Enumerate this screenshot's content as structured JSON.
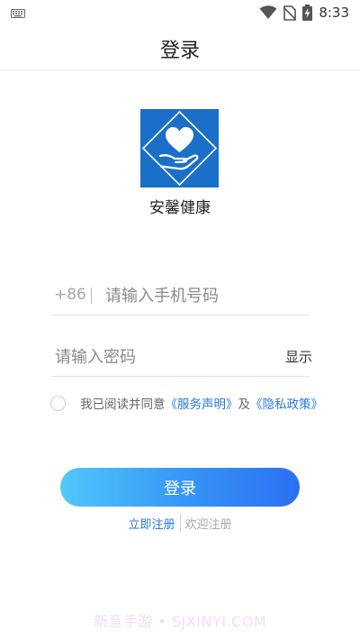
{
  "status_bar": {
    "time": "8:33",
    "icons": [
      "keyboard-icon",
      "wifi-icon",
      "no-sim-icon",
      "battery-charging-icon"
    ]
  },
  "header": {
    "title": "登录"
  },
  "app": {
    "name": "安馨健康",
    "logo_icon": "heart-hand-logo-icon",
    "logo_color": "#1a6fc9"
  },
  "phone_field": {
    "prefix": "+86",
    "placeholder": "请输入手机号码",
    "value": ""
  },
  "password_field": {
    "placeholder": "请输入密码",
    "value": "",
    "show_label": "显示"
  },
  "agreement": {
    "checked": false,
    "text": "我已阅读并同意",
    "service_link": "《服务声明》",
    "and": "及",
    "privacy_link": "《隐私政策》"
  },
  "login_button": {
    "label": "登录"
  },
  "footer": {
    "register_link": "立即注册",
    "welcome_text": "欢迎注册"
  },
  "watermark": "新意手游 • SJXINYI.COM",
  "colors": {
    "accent": "#2a78d6",
    "button_start": "#51c8fb",
    "button_end": "#2c6ff2"
  }
}
